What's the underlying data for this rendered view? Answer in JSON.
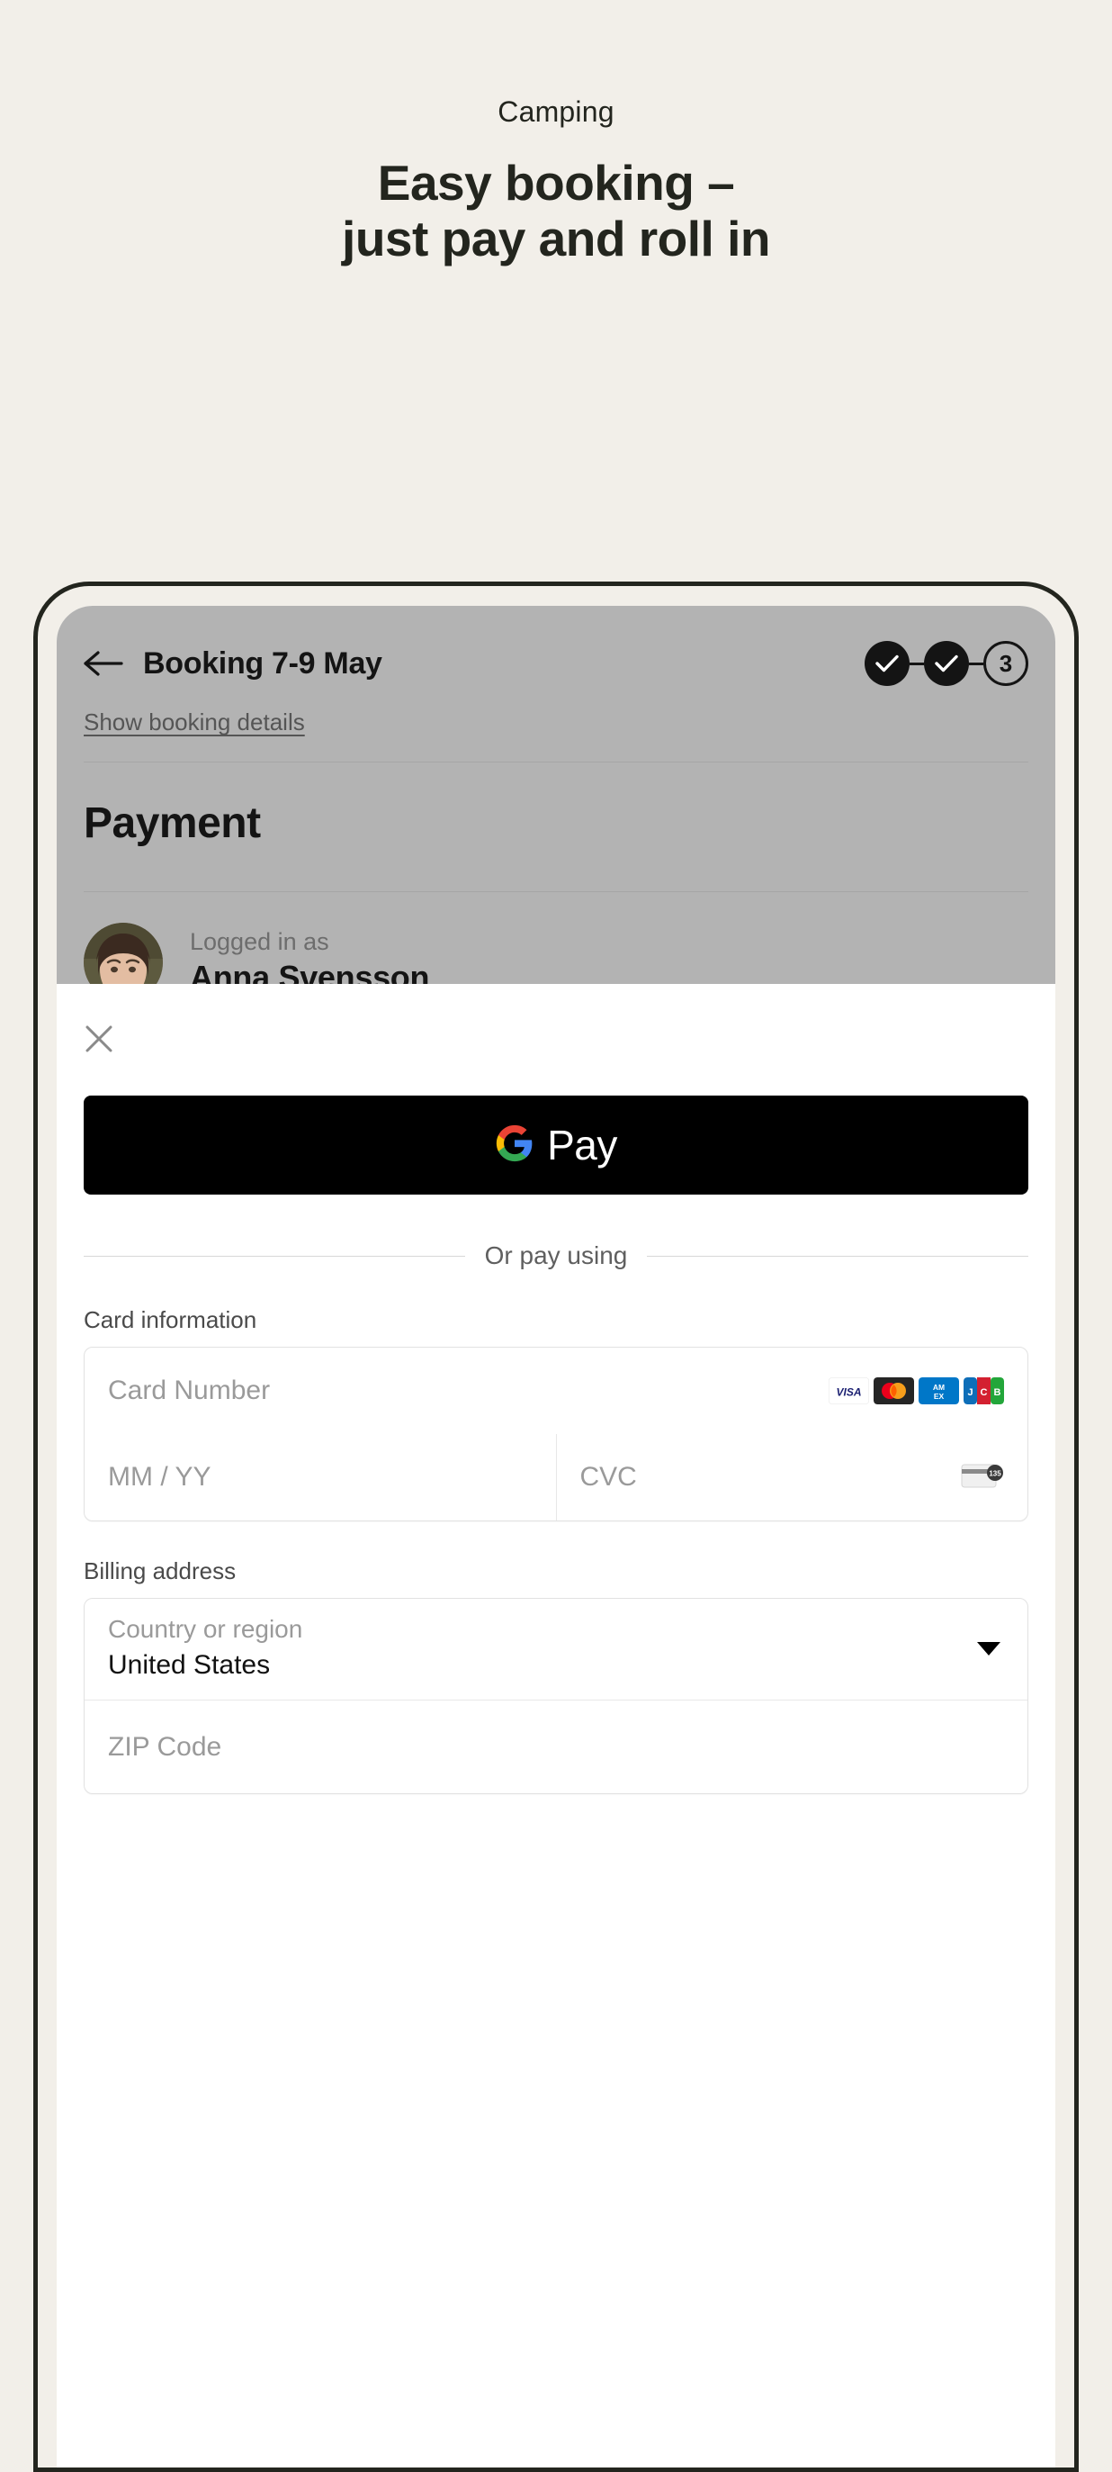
{
  "promo": {
    "eyebrow": "Camping",
    "title_line1": "Easy booking –",
    "title_line2": "just pay and roll in"
  },
  "booking": {
    "back_icon": "arrow-left-icon",
    "title": "Booking 7-9 May",
    "show_details_link": "Show booking details",
    "section_title": "Payment",
    "steps": [
      {
        "state": "done",
        "label": "✓"
      },
      {
        "state": "done",
        "label": "✓"
      },
      {
        "state": "current",
        "label": "3"
      }
    ],
    "account": {
      "logged_label": "Logged in as",
      "name": "Anna Svensson",
      "avatar": "user-avatar"
    }
  },
  "sheet": {
    "close_icon": "close-icon",
    "gpay": {
      "label": "Pay",
      "logo": "google-g-icon"
    },
    "divider_text": "Or pay using",
    "card_section_label": "Card information",
    "card_number_placeholder": "Card Number",
    "expiry_placeholder": "MM / YY",
    "cvc_placeholder": "CVC",
    "card_brands": [
      "visa",
      "mastercard",
      "amex",
      "jcb"
    ],
    "cvc_hint_icon": "cvc-card-icon",
    "billing_section_label": "Billing address",
    "country_label": "Country or region",
    "country_value": "United States",
    "zip_placeholder": "ZIP Code"
  },
  "colors": {
    "page_background": "#f2efe9",
    "ink": "#23251e",
    "overlay_gray": "#b3b3b3",
    "sheet_white": "#ffffff",
    "gpay_black": "#000000",
    "border_gray": "#e2e2e2",
    "placeholder_gray": "#9a9a9a"
  }
}
